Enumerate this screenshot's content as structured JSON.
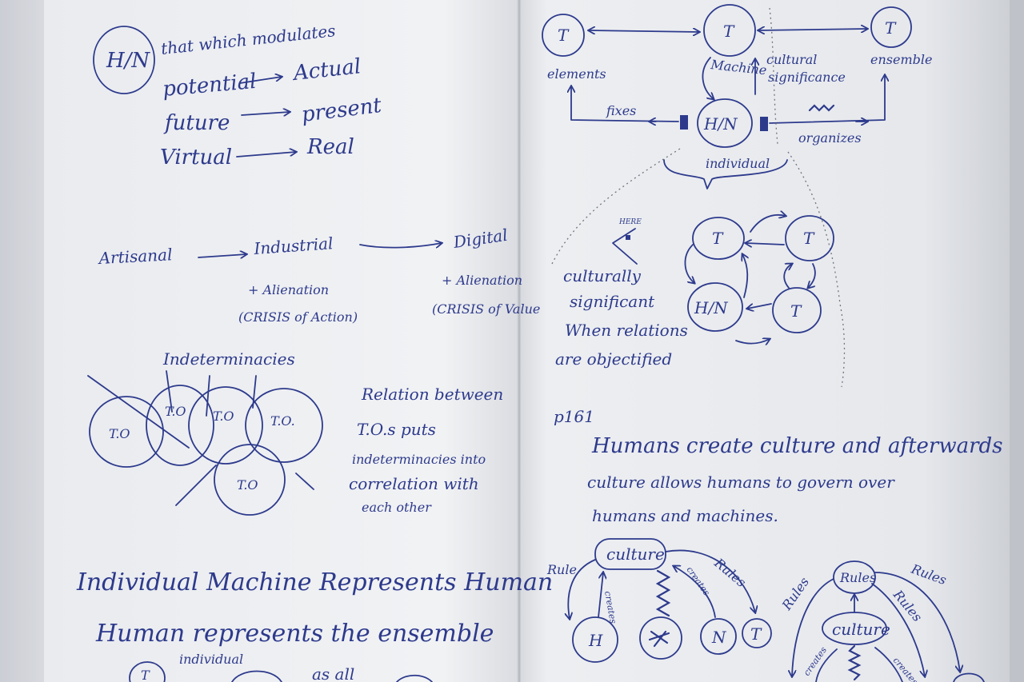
{
  "left_page": {
    "hn_label": "H/N",
    "definition": "that which modulates",
    "pairs": [
      {
        "from": "potential",
        "to": "Actual"
      },
      {
        "from": "future",
        "to": "present"
      },
      {
        "from": "Virtual",
        "to": "Real"
      }
    ],
    "stages": [
      "Artisanal",
      "Industrial",
      "Digital"
    ],
    "industrial_notes": [
      "+ Alienation",
      "(CRISIS of Action)"
    ],
    "digital_notes": [
      "+ Alienation",
      "(CRISIS of Value"
    ],
    "indeterminacies_label": "Indeterminacies",
    "to_label": "T.O",
    "to_circles": [
      "T.O",
      "T.O",
      "T.O",
      "T.O.",
      "T.O"
    ],
    "relation_text": [
      "Relation between",
      "T.O.s puts",
      "indeterminacies into",
      "correlation with",
      "each other"
    ],
    "bottom_lines": [
      "Individual Machine Represents Human",
      "Human represents the ensemble"
    ],
    "bottom_partial": [
      "T",
      "individual",
      "as all"
    ]
  },
  "right_page": {
    "t_label": "T",
    "hn_label": "H/N",
    "elements_label": "elements",
    "ensemble_label": "ensemble",
    "machine_label": "Machine",
    "cultural_significance": [
      "cultural",
      "significance"
    ],
    "fixes_label": "fixes",
    "organizes_label": "organizes",
    "individual_label": "individual",
    "here_label": "HERE",
    "culturally_text": [
      "culturally",
      "significant",
      "When relations",
      "are objectified"
    ],
    "page_ref": "p161",
    "humans_text": [
      "Humans create culture and afterwards",
      "culture allows humans to govern over",
      "humans and machines."
    ],
    "culture_label": "culture",
    "rule_label": "Rule",
    "creates_label": "creates",
    "rules_label": "Rules",
    "h_label": "H",
    "n_label": "N",
    "rules_node": "Rules"
  }
}
